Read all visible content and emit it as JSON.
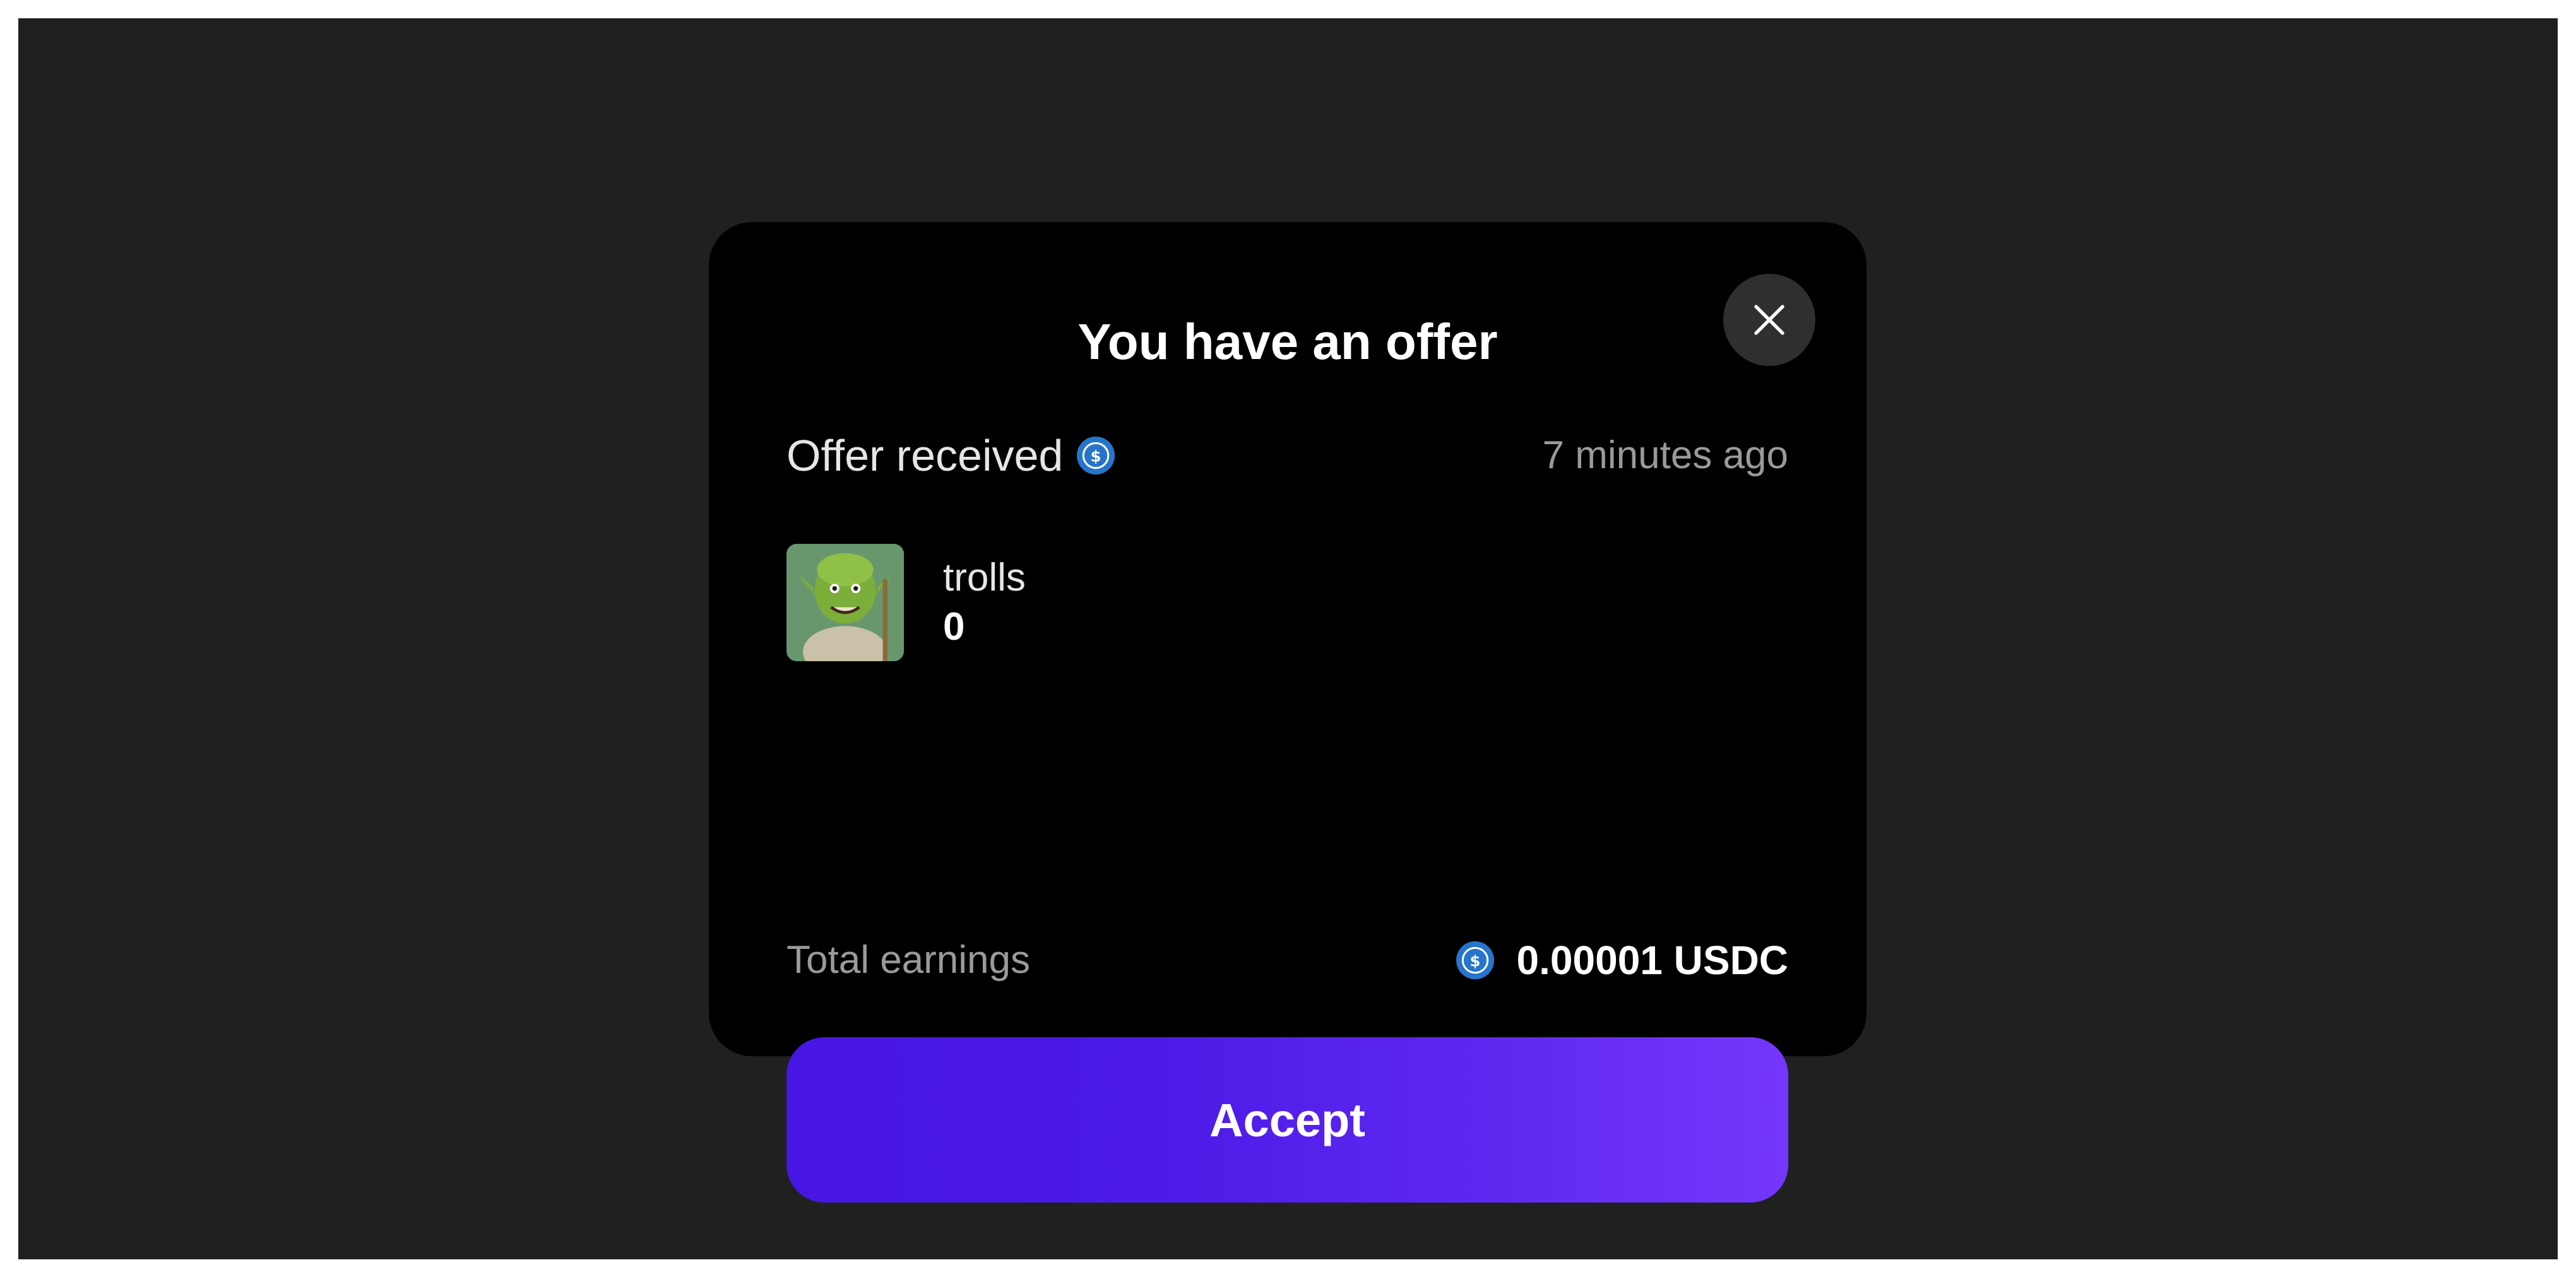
{
  "modal": {
    "title": "You have an offer",
    "received_label": "Offer received",
    "received_icon": "usdc-coin-icon",
    "time_ago": "7 minutes ago",
    "item": {
      "image": "troll-nft-thumbnail",
      "name": "trolls",
      "quantity": "0"
    },
    "earnings_label": "Total earnings",
    "earnings_icon": "usdc-coin-icon",
    "earnings_value": "0.00001 USDC",
    "accept_label": "Accept",
    "close_icon": "close-icon"
  },
  "colors": {
    "backdrop": "#202020",
    "modal_bg": "#000000",
    "accent_start": "#4716e2",
    "accent_end": "#7437fb",
    "usdc_blue": "#2775ca"
  }
}
